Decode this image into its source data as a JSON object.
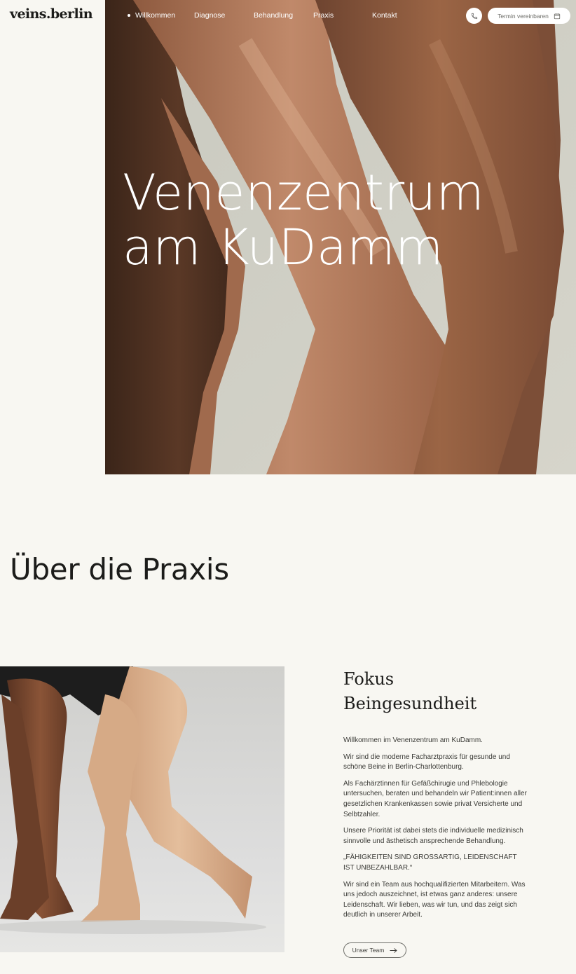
{
  "brand": {
    "logo": "veins.berlin"
  },
  "nav": {
    "items": [
      {
        "label": "Willkommen",
        "active": true
      },
      {
        "label": "Diagnose"
      },
      {
        "label": "Behandlung"
      },
      {
        "label": "Praxis"
      },
      {
        "label": "Kontakt"
      }
    ],
    "phone_icon": "phone-icon",
    "cta_label": "Termin vereinbaren",
    "cta_icon": "calendar-icon"
  },
  "hero": {
    "title_line1": "Venenzentrum",
    "title_line2": "am KuDamm"
  },
  "about": {
    "section_title": "Über die Praxis",
    "heading_line1": "Fokus",
    "heading_line2": "Beingesundheit",
    "paragraphs": [
      "Willkommen im Venenzentrum am KuDamm.",
      "Wir sind die moderne Facharztpraxis für gesunde und schöne Beine in Berlin-Charlottenburg.",
      "Als Fachärztinnen für Gefäßchirugie und Phlebologie untersuchen, beraten und behandeln wir Patient:innen aller gesetzlichen Krankenkassen sowie privat Versicherte und Selbtzahler.",
      "Unsere Priorität ist dabei stets die individuelle medizinisch sinnvolle und ästhetisch ansprechende Behandlung.",
      "„FÄHIGKEITEN SIND GROSSARTIG, LEIDENSCHAFT IST UNBEZAHLBAR.“",
      "Wir sind ein Team aus hochqualifizierten Mitarbeitern. Was uns jedoch auszeichnet, ist etwas ganz anderes: unsere Leidenschaft. Wir lieben, was wir tun, und das zeigt sich deutlich in unserer Arbeit."
    ],
    "team_button": "Unser Team",
    "team_button_icon": "arrow-right-icon"
  },
  "colors": {
    "background": "#f8f7f2",
    "text": "#1c1c1a",
    "nav_text": "#ffffff"
  }
}
